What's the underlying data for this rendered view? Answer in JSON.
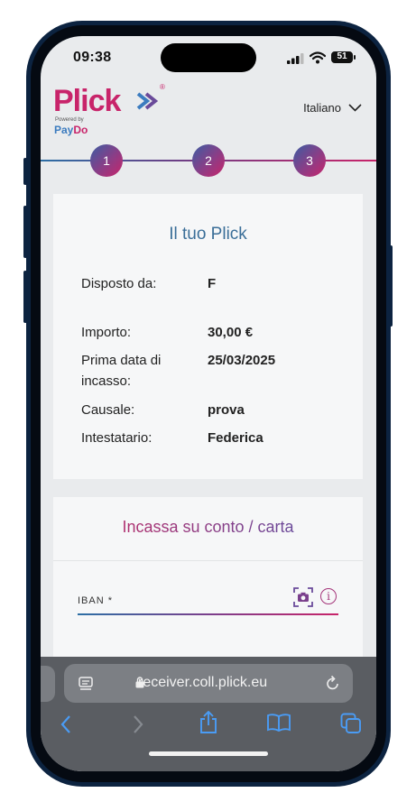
{
  "status_bar": {
    "time": "09:38",
    "battery": "51"
  },
  "header": {
    "logo_text": "Plick",
    "logo_sub": "Powered by",
    "logo_brand_a": "Pay",
    "logo_brand_b": "Do",
    "language": "Italiano"
  },
  "stepper": {
    "steps": [
      "1",
      "2",
      "3"
    ]
  },
  "summary": {
    "title": "Il tuo Plick",
    "rows": [
      {
        "label": "Disposto da:",
        "value": "F"
      },
      {
        "label": "Importo:",
        "value": "30,00 €"
      },
      {
        "label": "Prima data di incasso:",
        "value": "25/03/2025"
      },
      {
        "label": "Causale:",
        "value": "prova"
      },
      {
        "label": "Intestatario:",
        "value": "Federica"
      }
    ]
  },
  "collect": {
    "title": "Incassa su conto / carta",
    "iban_label": "IBAN *",
    "info_glyph": "i"
  },
  "browser": {
    "url": "receiver.coll.plick.eu"
  },
  "colors": {
    "brand_pink": "#c8246a",
    "brand_blue": "#3a6e98",
    "screen_bg": "#e9ebed"
  }
}
